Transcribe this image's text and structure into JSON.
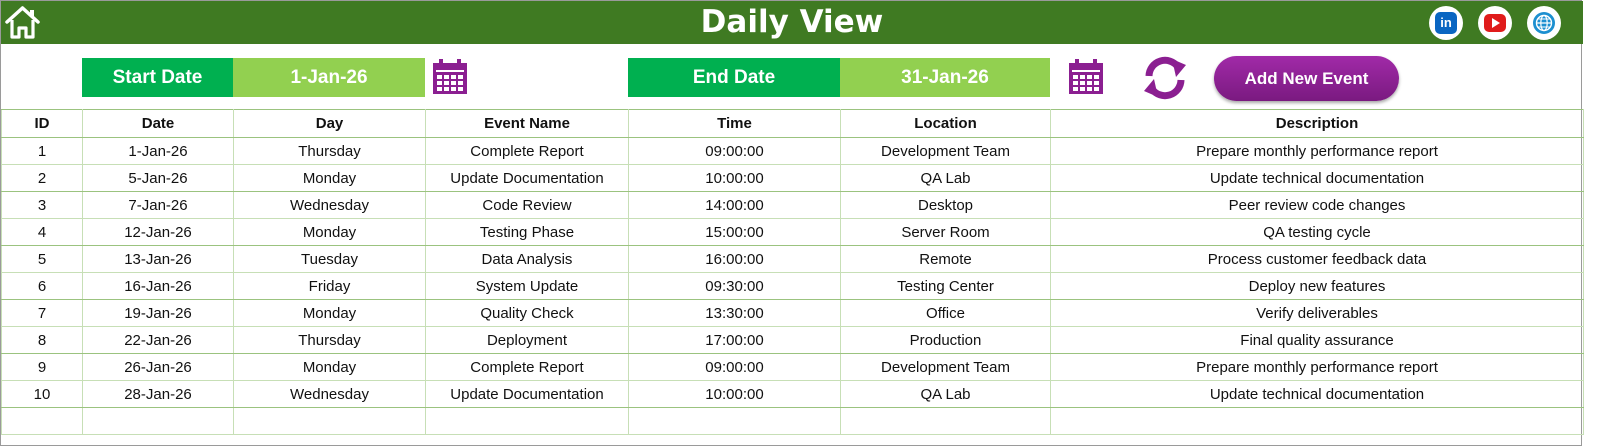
{
  "header": {
    "title": "Daily View",
    "social": {
      "linkedin": "in"
    }
  },
  "filters": {
    "start_label": "Start Date",
    "start_value": "1-Jan-26",
    "end_label": "End Date",
    "end_value": "31-Jan-26"
  },
  "actions": {
    "add_label": "Add New Event"
  },
  "colors": {
    "header_green": "#3f7a22",
    "label_green": "#00b050",
    "value_green": "#92d050",
    "accent_purple": "#8b1f91"
  },
  "icons": [
    "home-icon",
    "linkedin-icon",
    "youtube-icon",
    "globe-icon",
    "calendar-icon",
    "refresh-icon"
  ],
  "table": {
    "columns": [
      "ID",
      "Date",
      "Day",
      "Event Name",
      "Time",
      "Location",
      "Description"
    ],
    "rows": [
      [
        "1",
        "1-Jan-26",
        "Thursday",
        "Complete Report",
        "09:00:00",
        "Development Team",
        "Prepare monthly performance report"
      ],
      [
        "2",
        "5-Jan-26",
        "Monday",
        "Update Documentation",
        "10:00:00",
        "QA Lab",
        "Update technical documentation"
      ],
      [
        "3",
        "7-Jan-26",
        "Wednesday",
        "Code Review",
        "14:00:00",
        "Desktop",
        "Peer review code changes"
      ],
      [
        "4",
        "12-Jan-26",
        "Monday",
        "Testing Phase",
        "15:00:00",
        "Server Room",
        "QA testing cycle"
      ],
      [
        "5",
        "13-Jan-26",
        "Tuesday",
        "Data Analysis",
        "16:00:00",
        "Remote",
        "Process customer feedback data"
      ],
      [
        "6",
        "16-Jan-26",
        "Friday",
        "System Update",
        "09:30:00",
        "Testing Center",
        "Deploy new features"
      ],
      [
        "7",
        "19-Jan-26",
        "Monday",
        "Quality Check",
        "13:30:00",
        "Office",
        "Verify deliverables"
      ],
      [
        "8",
        "22-Jan-26",
        "Thursday",
        "Deployment",
        "17:00:00",
        "Production",
        "Final quality assurance"
      ],
      [
        "9",
        "26-Jan-26",
        "Monday",
        "Complete Report",
        "09:00:00",
        "Development Team",
        "Prepare monthly performance report"
      ],
      [
        "10",
        "28-Jan-26",
        "Wednesday",
        "Update Documentation",
        "10:00:00",
        "QA Lab",
        "Update technical documentation"
      ],
      [
        "",
        "",
        "",
        "",
        "",
        "",
        ""
      ]
    ]
  }
}
